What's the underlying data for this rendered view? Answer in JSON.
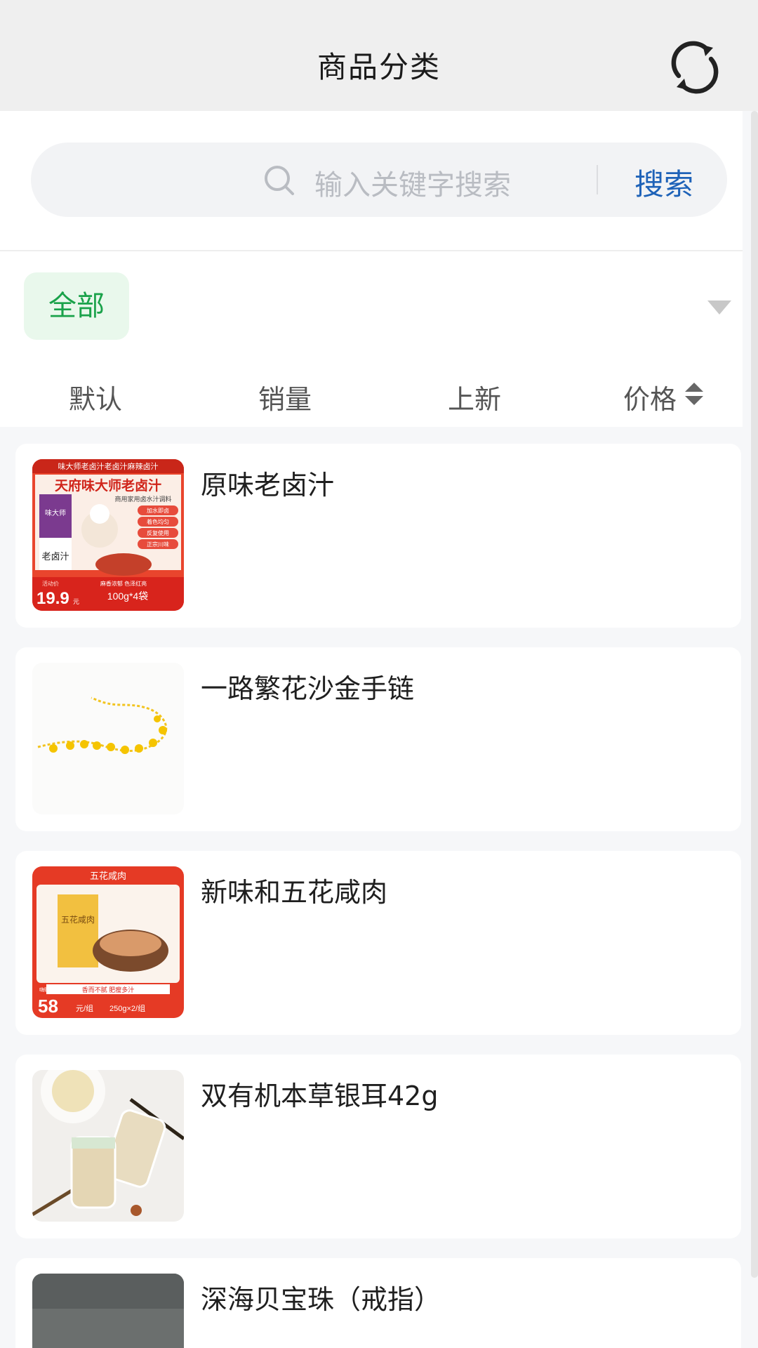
{
  "header": {
    "title": "商品分类",
    "refresh_icon": "refresh-icon"
  },
  "search": {
    "placeholder": "输入关键字搜索",
    "button_label": "搜索",
    "icon": "search-icon"
  },
  "filter": {
    "selected_category": "全部",
    "dropdown_icon": "chevron-down-icon",
    "accent_color": "#1aa24a"
  },
  "sort_tabs": [
    {
      "label": "默认"
    },
    {
      "label": "销量"
    },
    {
      "label": "上新"
    },
    {
      "label": "价格",
      "icon": "sort-arrows-icon"
    }
  ],
  "products": [
    {
      "title": "原味老卤汁",
      "thumb": {
        "top_banner": "味大师老卤汁老卤汁麻辣卤汁",
        "headline": "天府味大师老卤汁",
        "subline": "商用家用卤水汁调料",
        "features": [
          "加水即卤",
          "着色均匀",
          "反复使用",
          "正宗川味"
        ],
        "package_brand": "味大师",
        "package_text": "老卤汁",
        "price_tag": "活动价",
        "price": "19.9",
        "price_unit": "元",
        "tagline": "麻香浓郁 色泽红亮",
        "spec": "100g*4袋"
      }
    },
    {
      "title": "一路繁花沙金手链",
      "thumb": {}
    },
    {
      "title": "新味和五花咸肉",
      "thumb": {
        "banner": "五花咸肉",
        "package_text": "五花咸肉",
        "price_tag": "嗨购价",
        "price": "58",
        "price_unit": "元/组",
        "spec": "250g×2/组",
        "tagline": "香而不腻 肥瘦多汁"
      }
    },
    {
      "title": "双有机本草银耳42g",
      "thumb": {}
    },
    {
      "title": "深海贝宝珠（戒指）",
      "thumb": {}
    }
  ]
}
